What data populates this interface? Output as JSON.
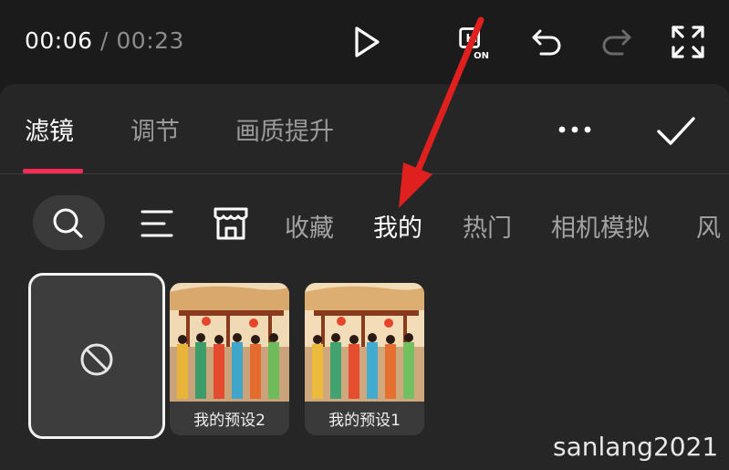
{
  "player": {
    "current_time": "00:06",
    "separator": "/",
    "duration": "00:23",
    "hd_badge": "ON",
    "icons": [
      "play-icon",
      "hd-toggle-icon",
      "undo-icon",
      "redo-icon",
      "fullscreen-icon"
    ]
  },
  "panel": {
    "tabs": [
      {
        "label": "滤镜",
        "active": true
      },
      {
        "label": "调节",
        "active": false
      },
      {
        "label": "画质提升",
        "active": false
      }
    ],
    "more_icon": "more-dots-icon",
    "confirm_icon": "checkmark-icon"
  },
  "categories": {
    "search_icon": "search-icon",
    "list_icon": "list-icon",
    "store_icon": "store-icon",
    "items": [
      {
        "label": "收藏",
        "active": false
      },
      {
        "label": "我的",
        "active": true
      },
      {
        "label": "热门",
        "active": false
      },
      {
        "label": "相机模拟",
        "active": false
      },
      {
        "label": "风",
        "active": false
      }
    ]
  },
  "filters": {
    "none_icon": "none-filter-icon",
    "presets": [
      {
        "label": "我的预设2"
      },
      {
        "label": "我的预设1"
      }
    ]
  },
  "watermark": "sanlang2021",
  "colors": {
    "accent": "#fe2c55",
    "annotation_arrow": "#e0201e",
    "background": "#1b1b1b",
    "panel": "#262626"
  }
}
